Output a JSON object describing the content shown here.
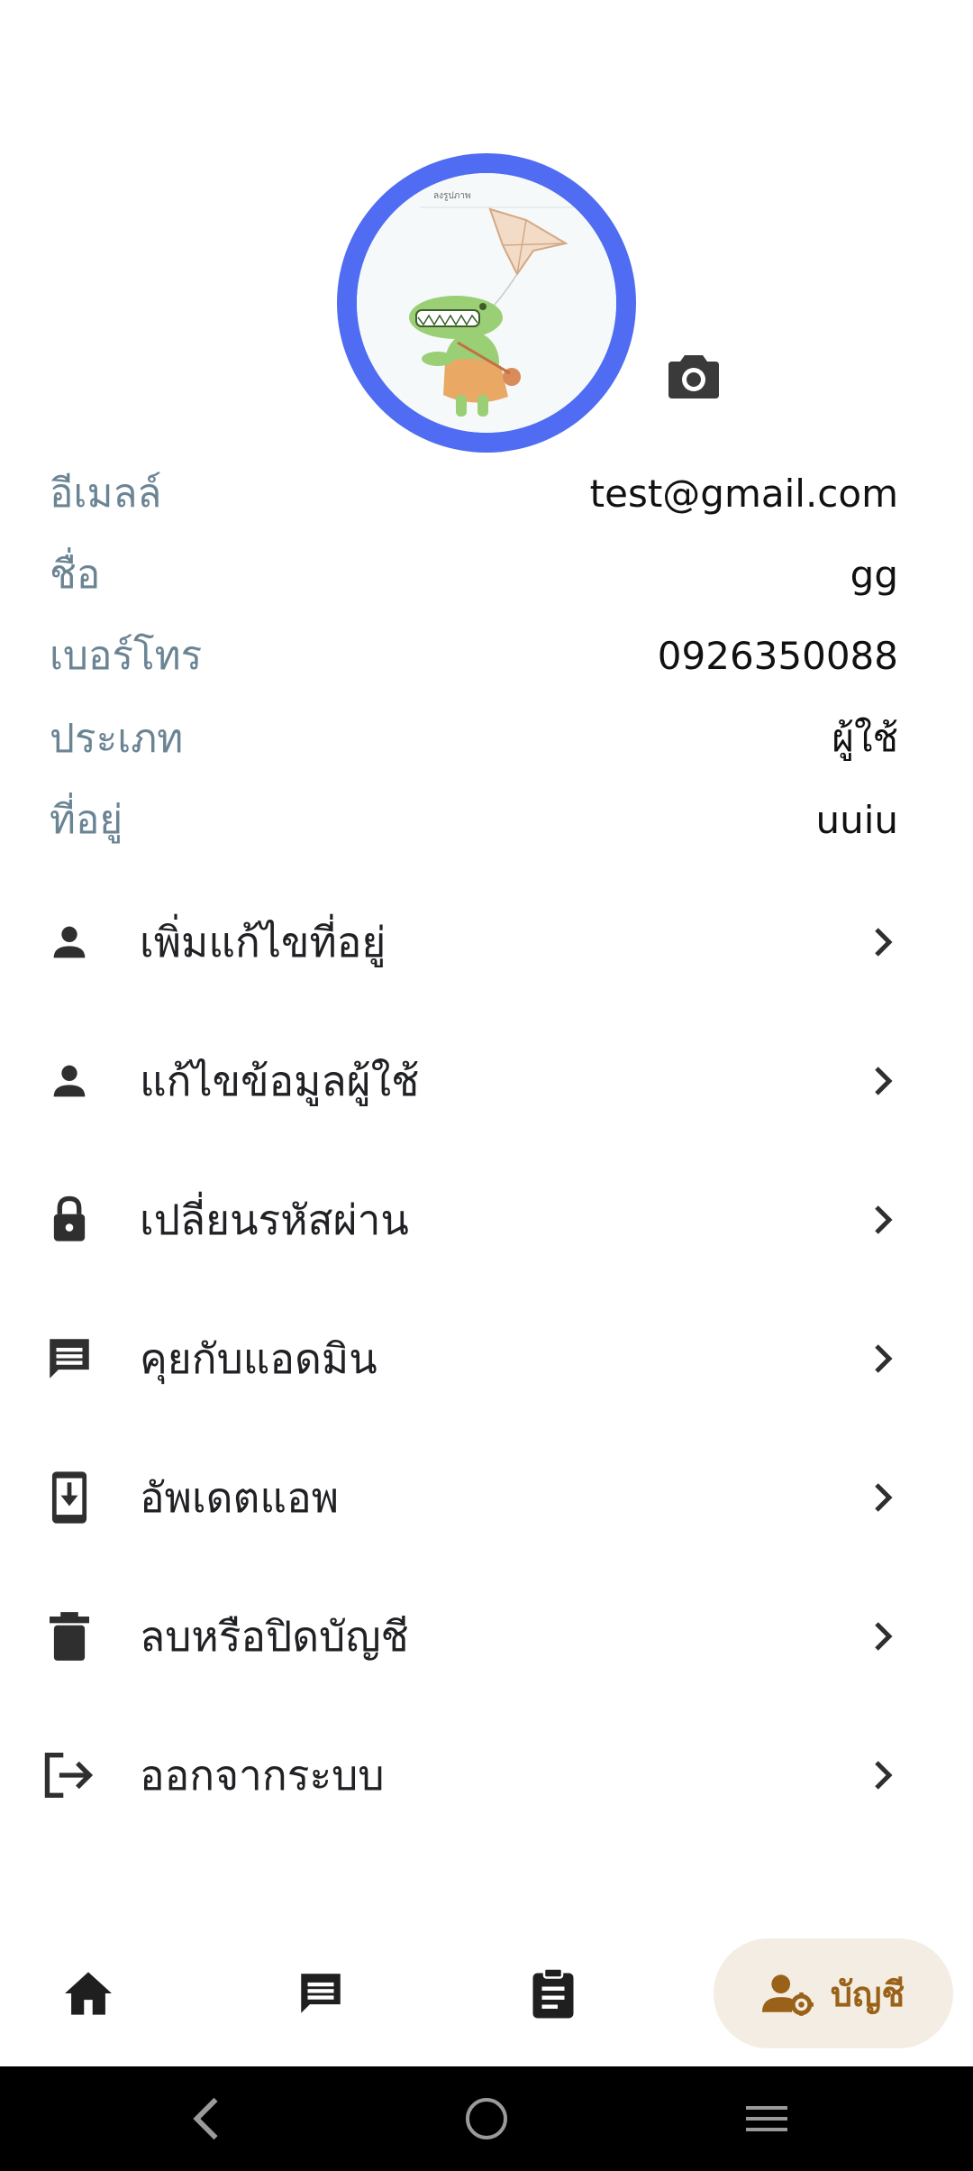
{
  "profile": {
    "avatar_caption": "ลงรูปภาพ",
    "fields": [
      {
        "label": "อีเมลล์",
        "value": "test@gmail.com"
      },
      {
        "label": "ชื่อ",
        "value": "gg"
      },
      {
        "label": "เบอร์โทร",
        "value": "0926350088"
      },
      {
        "label": "ประเภท",
        "value": "ผู้ใช้"
      },
      {
        "label": "ที่อยู่",
        "value": "uuiu"
      }
    ]
  },
  "menu": {
    "items": [
      {
        "label": "เพิ่มแก้ไขที่อยู่",
        "icon": "person-icon"
      },
      {
        "label": "แก้ไขข้อมูลผู้ใช้",
        "icon": "person-icon"
      },
      {
        "label": "เปลี่ยนรหัสผ่าน",
        "icon": "lock-icon"
      },
      {
        "label": "คุยกับแอดมิน",
        "icon": "chat-icon"
      },
      {
        "label": "อัพเดตแอพ",
        "icon": "phone-download-icon"
      },
      {
        "label": "ลบหรือปิดบัญชี",
        "icon": "trash-icon"
      },
      {
        "label": "ออกจากระบบ",
        "icon": "logout-icon"
      }
    ]
  },
  "bottom_nav": {
    "active_label": "บัญชี",
    "active_color": "#9a6218"
  },
  "colors": {
    "avatar_ring": "#4f6cf2",
    "label": "#6b8494",
    "icon": "#2f2f2f"
  }
}
